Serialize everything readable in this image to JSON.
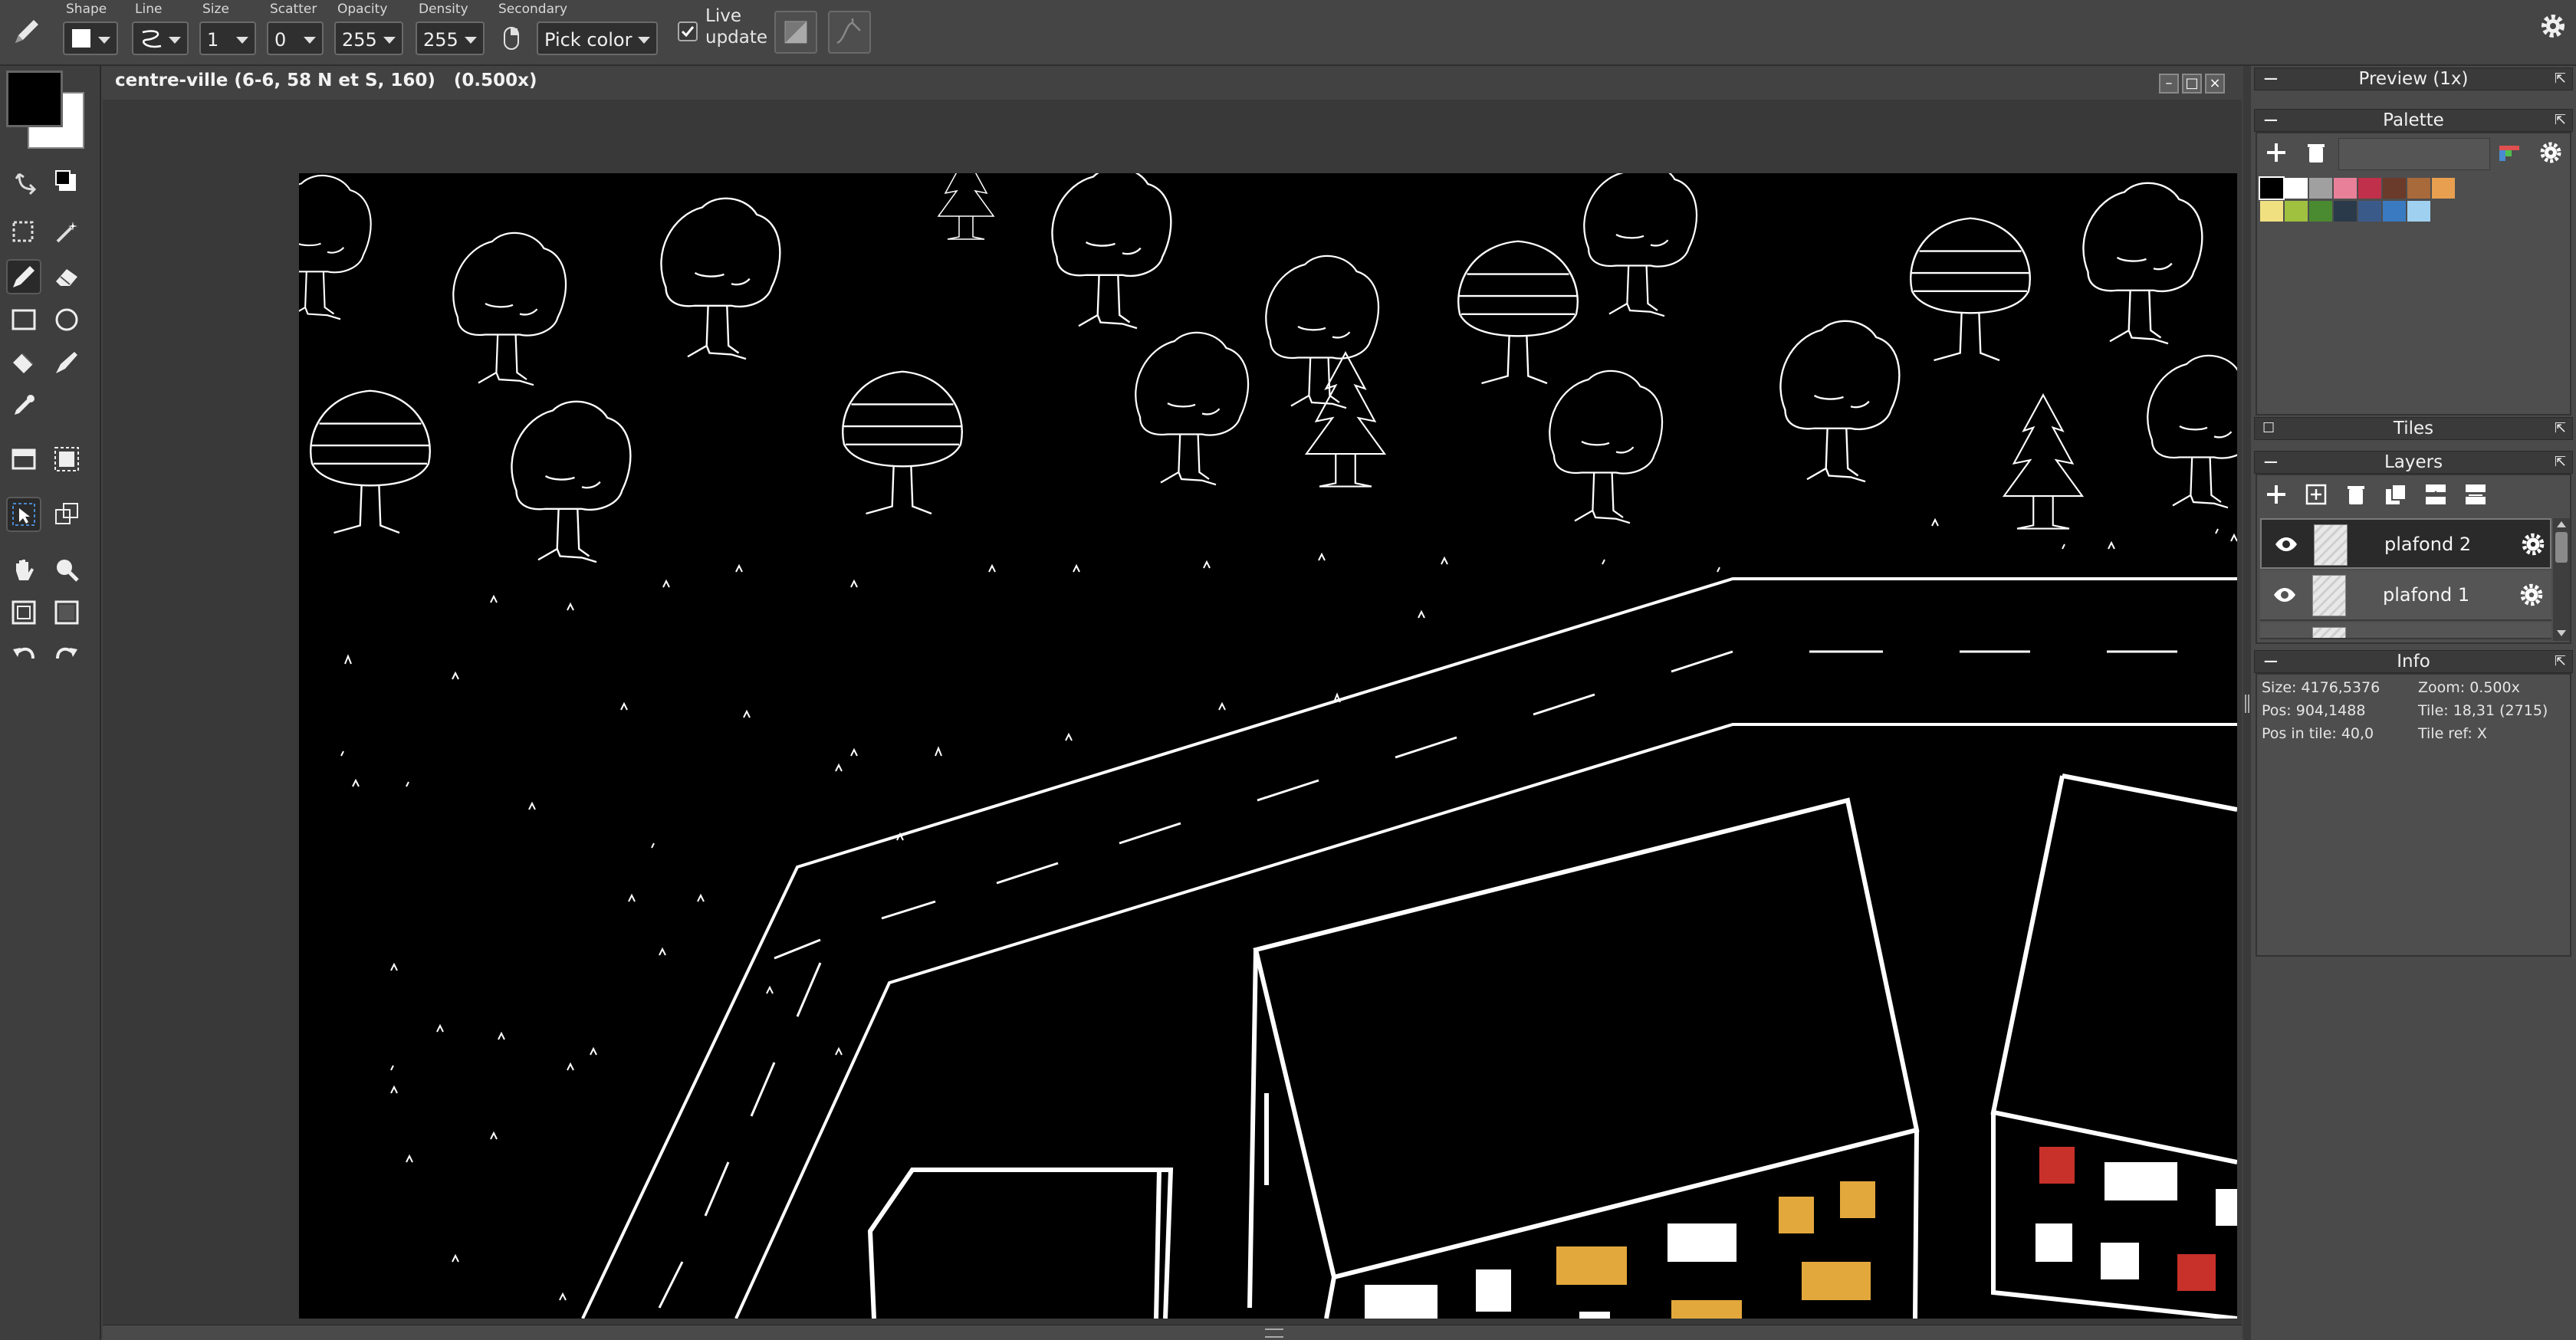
{
  "toolbar": {
    "shape_label": "Shape",
    "line_label": "Line",
    "size_label": "Size",
    "size_value": "1",
    "scatter_label": "Scatter",
    "scatter_value": "0",
    "opacity_label": "Opacity",
    "opacity_value": "255",
    "density_label": "Density",
    "density_value": "255",
    "secondary_label": "Secondary",
    "secondary_value": "Pick color",
    "live_update_line1": "Live",
    "live_update_line2": "update"
  },
  "document": {
    "title": "centre-ville (6-6, 58 N et S, 160)   (0.500x)",
    "win_min": "–",
    "win_max": "□",
    "win_close": "×"
  },
  "panels": {
    "preview_title": "Preview (1x)",
    "palette_title": "Palette",
    "tiles_title": "Tiles",
    "layers_title": "Layers",
    "info_title": "Info"
  },
  "palette": {
    "row1": [
      "#000000",
      "#ffffff",
      "#a0a0a0",
      "#e8809a",
      "#c0304a",
      "#6a3a2a",
      "#a86a3a",
      "#e8a050"
    ],
    "row2": [
      "#f0e080",
      "#a0c040",
      "#4a8a30",
      "#2a3a4a",
      "#3a5a8a",
      "#3a7ac0",
      "#a0d0f0"
    ]
  },
  "layers": [
    {
      "name": "plafond 2"
    },
    {
      "name": "plafond 1"
    }
  ],
  "info": {
    "size": "Size: 4176,5376",
    "zoom": "Zoom: 0.500x",
    "pos": "Pos: 904,1488",
    "tile": "Tile: 18,31 (2715)",
    "pos_in_tile": "Pos in tile: 40,0",
    "tile_ref": "Tile ref: X"
  },
  "colors": {
    "primary": "#000000",
    "secondary": "#ffffff",
    "window_orange": "#e3a83c",
    "window_red": "#c8302a"
  }
}
